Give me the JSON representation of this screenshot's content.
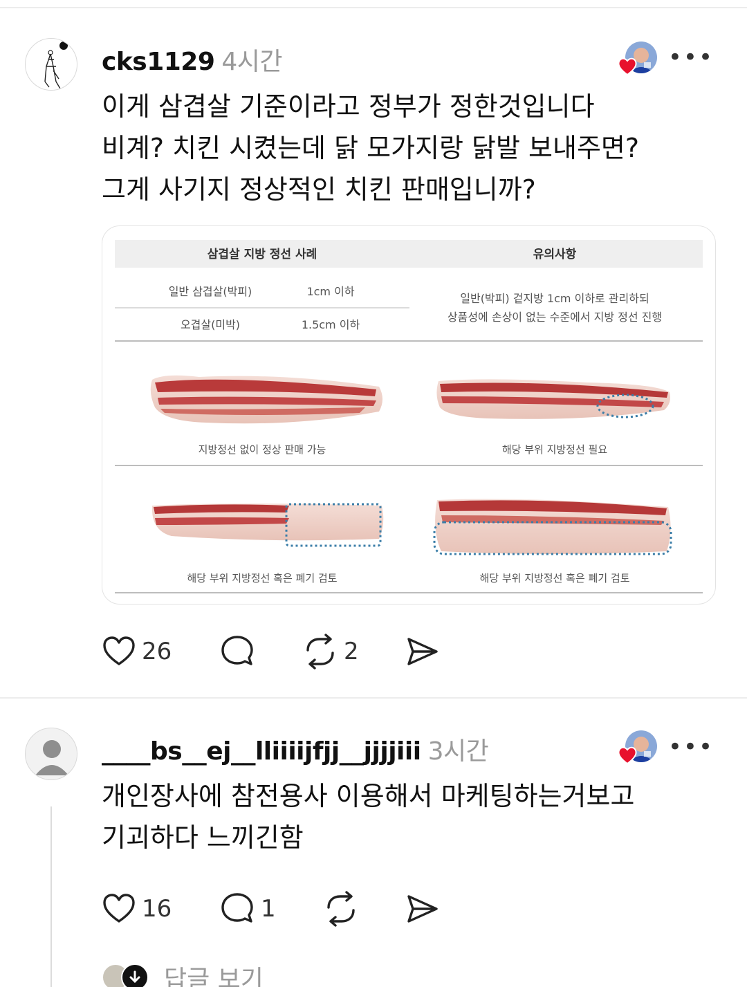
{
  "post1": {
    "username": "cks1129",
    "time": "4시간",
    "lines": [
      "이게  삼겹살 기준이라고 정부가 정한것입니다",
      "비계? 치킨 시켰는데  닭 모가지랑 닭발 보내주면?",
      "그게 사기지  정상적인 치킨 판매입니까?"
    ],
    "image": {
      "left_header": "삼겹살 지방 정선 사례",
      "right_header": "유의사항",
      "rows": [
        {
          "name": "일반 삼겹살(박피)",
          "value": "1cm 이하"
        },
        {
          "name": "오겹살(미박)",
          "value": "1.5cm 이하"
        }
      ],
      "note_lines": [
        "일반(박피) 겉지방 1cm 이하로 관리하되",
        "상품성에 손상이 없는 수준에서 지방 정선 진행"
      ],
      "captions": [
        "지방정선 없이 정상 판매 가능",
        "해당 부위 지방정선 필요",
        "해당 부위 지방정선 혹은 폐기 검토",
        "해당 부위 지방정선 혹은 폐기 검토"
      ]
    },
    "likes": "26",
    "reposts": "2"
  },
  "post2": {
    "username": "____bs__ej__lliiiijfjj__jjjjiii",
    "time": "3시간",
    "lines": [
      "개인장사에 참전용사 이용해서 마케팅하는거보고",
      "기괴하다 느끼긴함"
    ],
    "likes": "16",
    "replies": "1",
    "view_replies": "답글 보기"
  },
  "icons": {
    "heart": "heart-icon",
    "comment": "comment-icon",
    "repost": "repost-icon",
    "share": "send-icon",
    "more": "more-icon"
  },
  "colors": {
    "text": "#111111",
    "muted": "#9a9a9a",
    "like_red": "#e8112d",
    "dotted_outline": "#3b7ea8"
  }
}
